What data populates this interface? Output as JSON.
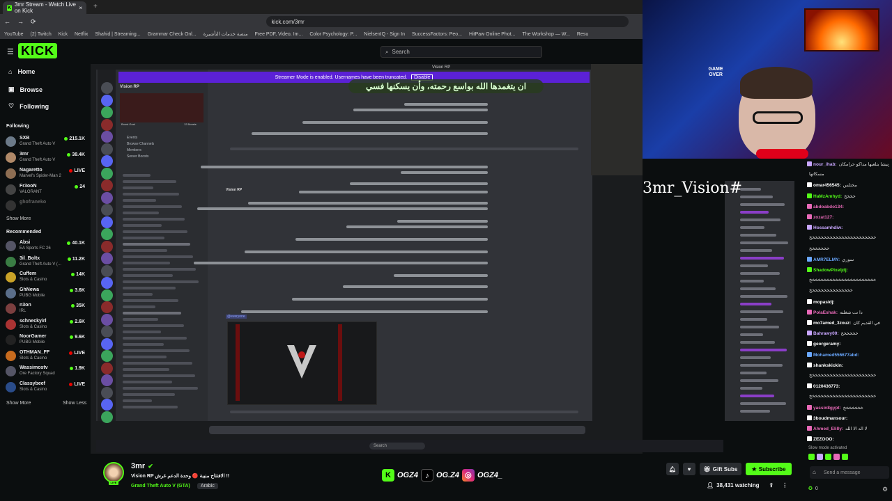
{
  "browser": {
    "tab_title": "3mr Stream - Watch Live on Kick",
    "tab_close": "×",
    "new_tab": "+",
    "url": "kick.com/3mr",
    "bookmarks": [
      "YouTube",
      "(2) Twitch",
      "Kick",
      "Netflix",
      "Shahid | Streaming...",
      "Grammar Check Onl...",
      "منصة خدمات التأشيرة",
      "Free PDF, Video, Im...",
      "Color Psychology: P...",
      "NielsenIQ - Sign In",
      "SuccessFactors: Peo...",
      "HitPaw Online Phot...",
      "The Workshop — W...",
      "Resu"
    ]
  },
  "kick": {
    "logo": "KICK",
    "search_placeholder": "Search",
    "nav": [
      {
        "label": "Home",
        "icon": "home-icon"
      },
      {
        "label": "Browse",
        "icon": "browse-icon"
      },
      {
        "label": "Following",
        "icon": "heart-icon"
      }
    ],
    "following_title": "Following",
    "following": [
      {
        "name": "SXB",
        "game": "Grand Theft Auto V",
        "viewers": "215.1K",
        "status": "green",
        "color": "#6c7a89"
      },
      {
        "name": "3mr",
        "game": "Grand Theft Auto V",
        "viewers": "38.4K",
        "status": "green",
        "color": "#b08968"
      },
      {
        "name": "Nagaretto",
        "game": "Marvel's Spider-Man 2",
        "viewers": "LIVE",
        "status": "red",
        "color": "#8e6e53"
      },
      {
        "name": "Fr3ooN",
        "game": "VALORANT",
        "viewers": "24",
        "status": "green",
        "color": "#444"
      },
      {
        "name": "ghofraneko",
        "game": "",
        "viewers": "",
        "status": "none",
        "color": "#333"
      }
    ],
    "show_more": "Show More",
    "recommended_title": "Recommended",
    "recommended": [
      {
        "name": "Absi",
        "game": "EA Sports FC 26",
        "viewers": "40.1K",
        "status": "green",
        "color": "#556"
      },
      {
        "name": "3il_Boltx",
        "game": "Grand Theft Auto V (...",
        "viewers": "11.2K",
        "status": "green",
        "color": "#3a7d44"
      },
      {
        "name": "Cuffem",
        "game": "Slots & Casino",
        "viewers": "14K",
        "status": "green",
        "color": "#c9a227"
      },
      {
        "name": "GhNewa",
        "game": "PUBG Mobile",
        "viewers": "3.6K",
        "status": "green",
        "color": "#5a6e8a"
      },
      {
        "name": "n3on",
        "game": "IRL",
        "viewers": "35K",
        "status": "green",
        "color": "#7b3f3f"
      },
      {
        "name": "schneckyirl",
        "game": "Slots & Casino",
        "viewers": "2.6K",
        "status": "green",
        "color": "#a33"
      },
      {
        "name": "NoorGamer",
        "game": "PUBG Mobile",
        "viewers": "9.6K",
        "status": "green",
        "color": "#222"
      },
      {
        "name": "OTHMAN_FF",
        "game": "Slots & Casino",
        "viewers": "LIVE",
        "status": "red",
        "color": "#c76b1e"
      },
      {
        "name": "Wassimostv",
        "game": "Ore Factory Squad",
        "viewers": "1.9K",
        "status": "green",
        "color": "#556"
      },
      {
        "name": "Classybeef",
        "game": "Slots & Casino",
        "viewers": "LIVE",
        "status": "red",
        "color": "#2a4c8a"
      }
    ],
    "show_more_2": "Show More",
    "show_less": "Show Less"
  },
  "stream": {
    "discord_banner": "Streamer Mode is enabled. Usernames have been truncated.",
    "discord_banner_btn": "Disable",
    "discord_top": "Vision RP",
    "server_name": "Vision RP",
    "overlay_text": "ان يتغمدها الله بواسع رحمته، وأن يسكنها فسي",
    "channel_labels": [
      "Events",
      "Browse Channels",
      "Members",
      "Server Boosts"
    ],
    "boost_goal": "Boost Goal",
    "boost_count": "12 Boosts",
    "msg_heading": "Vision RP",
    "mention": "@everyone",
    "taskbar_search": "Search",
    "overlay_tag": "3mr_Vision#"
  },
  "webcam": {
    "overlay_label": "GAME OVER"
  },
  "chat": {
    "messages": [
      {
        "user": "nour_ihab:",
        "text": "ونيشا بتلعبها مداكو حرامكان",
        "color": "#c9a7ff"
      },
      {
        "user": "",
        "text": "مسكاتها",
        "color": "#c9a7ff"
      },
      {
        "user": "omar456545:",
        "text": "مختلس",
        "color": "#ffffff"
      },
      {
        "user": "HaMzAmhyd:",
        "text": "خخخخ",
        "color": "#53fc18"
      },
      {
        "user": "abdoabdo134:",
        "text": "",
        "color": "#e86ab8"
      },
      {
        "user": "zozat127:",
        "text": "",
        "color": "#e86ab8"
      },
      {
        "user": "Hossamhdiw:",
        "text": "",
        "color": "#c9a7ff"
      },
      {
        "user": "",
        "text": "خخخخخخخخخخخخخخخخخخخخخخخ",
        "color": "#c9a7ff"
      },
      {
        "user": "",
        "text": "خخخخخخخ",
        "color": "#c9a7ff"
      },
      {
        "user": "AMR7ELMY:",
        "text": "سوري",
        "color": "#6aa8ff"
      },
      {
        "user": "ShadowPixeljdj:",
        "text": "",
        "color": "#53fc18"
      },
      {
        "user": "",
        "text": "خخخخخخخخخخخخخخخخخخخخخخخ",
        "color": "#53fc18"
      },
      {
        "user": "",
        "text": "خخخخخخخخخخخخخخخ",
        "color": "#53fc18"
      },
      {
        "user": "mopasidj:",
        "text": "",
        "color": "#ffffff"
      },
      {
        "user": "PolaEshak:",
        "text": "دا نت شغلته",
        "color": "#e86ab8"
      },
      {
        "user": "mo7amed_3zouz:",
        "text": "في القديم كان",
        "color": "#ffffff"
      },
      {
        "user": "Bahrawy00:",
        "text": "خخخخخخ",
        "color": "#c9a7ff"
      },
      {
        "user": "georgeramy:",
        "text": "",
        "color": "#ffffff"
      },
      {
        "user": "Mohamed556677abd:",
        "text": "",
        "color": "#6aa8ff"
      },
      {
        "user": "shankskickin:",
        "text": "",
        "color": "#ffffff"
      },
      {
        "user": "",
        "text": "خخخخخخخخخخخخخخخخخخخخخخخ",
        "color": "#ffffff"
      },
      {
        "user": "0120436773:",
        "text": "",
        "color": "#ffffff"
      },
      {
        "user": "",
        "text": "خخخخخخخخخخخخخخخخخخخخخخخ",
        "color": "#ffffff"
      },
      {
        "user": "yassin8gypt:",
        "text": "خخخخخخخ",
        "color": "#e86ab8"
      },
      {
        "user": "3boudmansour:",
        "text": "",
        "color": "#ffffff"
      },
      {
        "user": "Ahmed_Elilly:",
        "text": "لا اله الا الله",
        "color": "#e86ab8"
      },
      {
        "user": "ZEZOOO:",
        "text": "",
        "color": "#ffffff"
      }
    ],
    "slow_mode": "Slow mode activated",
    "input_placeholder": "Send a message",
    "points": "0"
  },
  "streamer": {
    "name": "3mr",
    "title": "Vision RP الافتتاح منيبة 🔴 وحدة الدعم غرش !!",
    "game": "Grand Theft Auto V (GTA)",
    "language": "Arabic",
    "live": "LIVE",
    "socials": [
      "OGZ4",
      "OG.Z4",
      "OGZ4_"
    ],
    "gift_subs": "Gift Subs",
    "subscribe": "Subscribe",
    "viewers": "38,431 watching"
  },
  "colors": {
    "brand": "#53fc18",
    "bg": "#0b0e0f",
    "live_red": "#eb0400",
    "discord_purple": "#5b21d6"
  }
}
